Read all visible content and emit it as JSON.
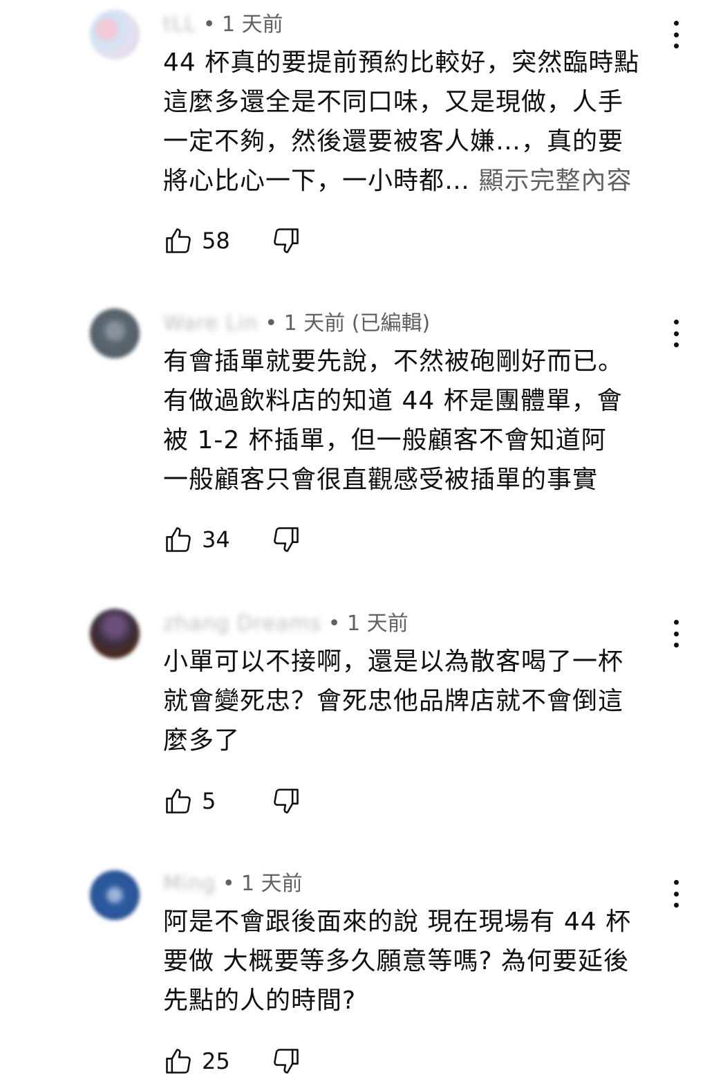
{
  "comments": [
    {
      "author": "tLL",
      "time": "• 1 天前",
      "avatar_color": "#d8cfe0",
      "lines": [
        "44 杯真的要提前預約比較好，突然臨時點",
        "這麼多還全是不同口味，又是現做，人手",
        "一定不夠，然後還要被客人嫌…，真的要",
        "將心比心一下，一小時都… "
      ],
      "show_more": "顯示完整內容",
      "likes": "58"
    },
    {
      "author": "Ware Lin",
      "time": "• 1 天前 (已編輯)",
      "avatar_color": "#5b6670",
      "lines": [
        "有會插單就要先說，不然被砲剛好而已。",
        "有做過飲料店的知道 44 杯是團體單，會",
        "被 1-2 杯插單，但一般顧客不會知道阿",
        "一般顧客只會很直觀感受被插單的事實"
      ],
      "likes": "34"
    },
    {
      "author": "zhang Dreams",
      "time": "• 1 天前",
      "avatar_color": "#3a2e3e",
      "lines": [
        "小單可以不接啊，還是以為散客喝了一杯",
        "就會變死忠？會死忠他品牌店就不會倒這",
        "麼多了"
      ],
      "likes": "5"
    },
    {
      "author": "Ming",
      "time": "• 1 天前",
      "avatar_color": "#2c5aa0",
      "lines": [
        "阿是不會跟後面來的說 現在現場有 44 杯",
        "要做 大概要等多久願意等嗎? 為何要延後",
        "先點的人的時間?"
      ],
      "likes": "25"
    }
  ]
}
